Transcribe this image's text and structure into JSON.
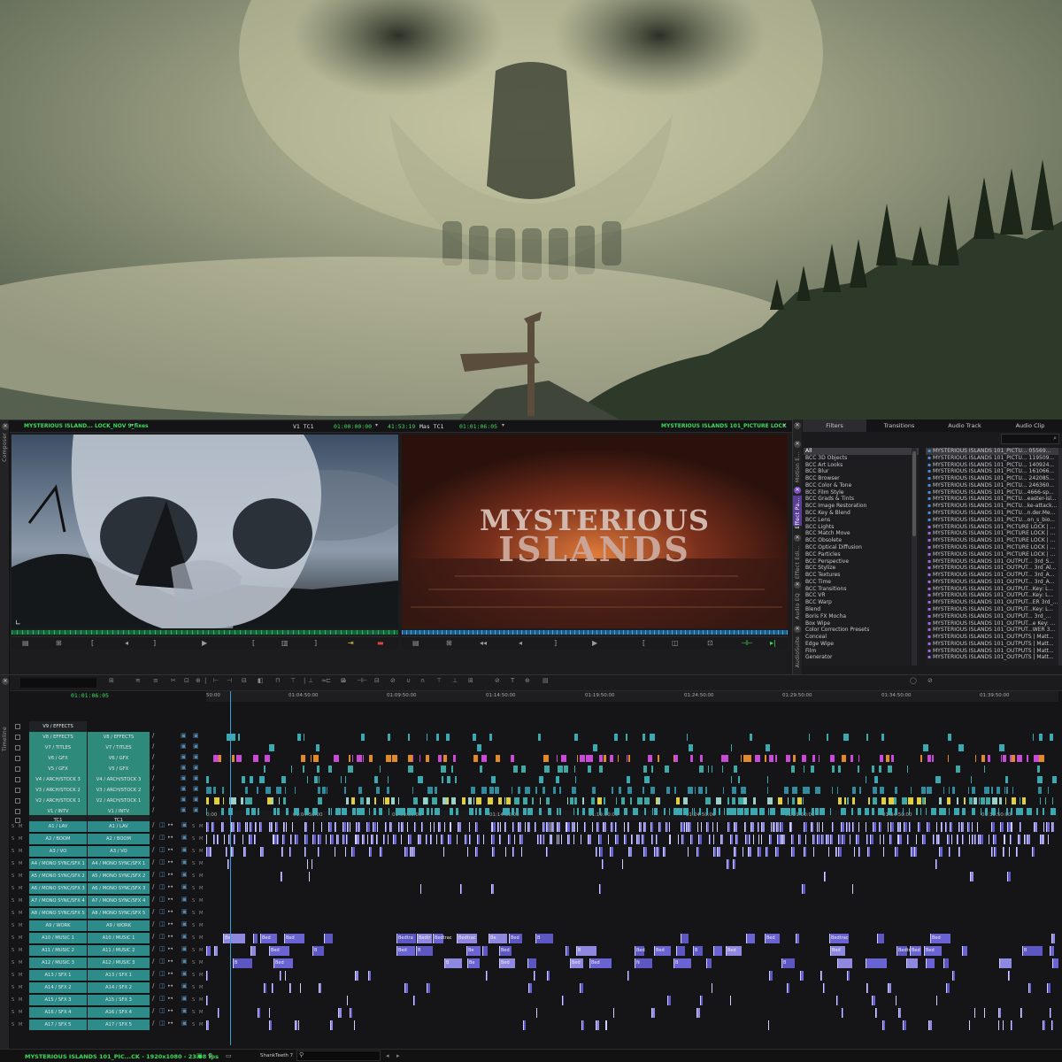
{
  "composer": {
    "side_label": "Composer",
    "source_title": "MYSTERIOUS ISLAND... LOCK_NOV 9_fixes",
    "record_title": "MYSTERIOUS ISLANDS 101_PICTURE LOCK",
    "track_label": "V1  TC1",
    "tc1": "01:00:00:00",
    "duration": "41:53:19",
    "mas_label": "Mas  TC1",
    "tc2": "01:01:06:05",
    "record_overlay_title": "MYSTERIOUS",
    "record_overlay_sub": "ISLANDS"
  },
  "effects": {
    "tabs": [
      "Filters",
      "Transitions",
      "Audio Track",
      "Audio Clip"
    ],
    "side_tabs": [
      "Motion E...",
      "Effect Pa...",
      "Effect Edi...",
      "Audio EQ",
      "AudioSuite"
    ],
    "categories": [
      "All",
      "BCC 3D Objects",
      "BCC Art Looks",
      "BCC Blur",
      "BCC Browser",
      "BCC Color & Tone",
      "BCC Film Style",
      "BCC Grads & Tints",
      "BCC Image Restoration",
      "BCC Key & Blend",
      "BCC Lens",
      "BCC Lights",
      "BCC Match Move",
      "BCC Obsolete",
      "BCC Optical Diffusion",
      "BCC Particles",
      "BCC Perspective",
      "BCC Stylize",
      "BCC Textures",
      "BCC Time",
      "BCC Transitions",
      "BCC VR",
      "BCC Warp",
      "Blend",
      "Boris FX Mocha",
      "Box Wipe",
      "Color Correction Presets",
      "Conceal",
      "Edge Wipe",
      "Film",
      "Generator"
    ],
    "clips": [
      "MYSTERIOUS ISLANDS 101_PICTU... 05569...",
      "MYSTERIOUS ISLANDS 101_PICTU... 119509...",
      "MYSTERIOUS ISLANDS 101_PICTU... 140924...",
      "MYSTERIOUS ISLANDS 101_PICTU... 161066...",
      "MYSTERIOUS ISLANDS 101_PICTU... 242085...",
      "MYSTERIOUS ISLANDS 101_PICTU... 246360...",
      "MYSTERIOUS ISLANDS 101_PICTU...4666-sp...",
      "MYSTERIOUS ISLANDS 101_PICTU...easter-isl...",
      "MYSTERIOUS ISLANDS 101_PICTU...ke-attack...",
      "MYSTERIOUS ISLANDS 101_PICTU...n.der.Me...",
      "MYSTERIOUS ISLANDS 101_PICTU...on_s_bio...",
      "MYSTERIOUS ISLANDS 101_PICTURE LOCK | ...",
      "MYSTERIOUS ISLANDS 101_PICTURE LOCK | ...",
      "MYSTERIOUS ISLANDS 101_PICTURE LOCK | ...",
      "MYSTERIOUS ISLANDS 101_PICTURE LOCK | ...",
      "MYSTERIOUS ISLANDS 101_PICTURE LOCK | ...",
      "MYSTERIOUS ISLANDS 101_OUTPUT... 3rd_S...",
      "MYSTERIOUS ISLANDS 101_OUTPUT... 3rd_Al...",
      "MYSTERIOUS ISLANDS 101_OUTPUT... 3rd_A...",
      "MYSTERIOUS ISLANDS 101_OUTPUT... 3rd_A...",
      "MYSTERIOUS ISLANDS 101_OUTPUT...Key: L...",
      "MYSTERIOUS ISLANDS 101_OUTPUT...Key: L...",
      "MYSTERIOUS ISLANDS 101_OUTPUT...ER 3rd_...",
      "MYSTERIOUS ISLANDS 101_OUTPUT...Key: L...",
      "MYSTERIOUS ISLANDS 101_OUTPUT... 3rd_...",
      "MYSTERIOUS ISLANDS 101_OUTPUT...e Key: ...",
      "MYSTERIOUS ISLANDS 101_OUTPUT...WER 3...",
      "MYSTERIOUS ISLANDS 101_OUTPUTS | Matt...",
      "MYSTERIOUS ISLANDS 101_OUTPUTS | Matt...",
      "MYSTERIOUS ISLANDS 101_OUTPUTS | Matt...",
      "MYSTERIOUS ISLANDS 101_OUTPUTS | Matt..."
    ]
  },
  "timeline": {
    "side_label": "Timeline",
    "current_tc": "01:01:06:05",
    "ruler_ticks": [
      "50:00",
      "01:04:50:00",
      "01:09:50:00",
      "01:14:50:00",
      "01:19:50:00",
      "01:24:50:00",
      "01:29:50:00",
      "01:34:50:00",
      "01:39:50:00"
    ],
    "ruler2_ticks": [
      "0:00",
      "01:04:50:00",
      "01:09:50:00",
      "01:14:50:00",
      "01:19:50:00",
      "01:24:50:00",
      "01:29:50:00",
      "01:34:50:00",
      "01:39:50:00"
    ],
    "video_tracks": [
      {
        "src": "V9 / EFFECTS",
        "rec": ""
      },
      {
        "src": "V8 / EFFECTS",
        "rec": "V8 / EFFECTS"
      },
      {
        "src": "V7 / TITLES",
        "rec": "V7 / TITLES"
      },
      {
        "src": "V6 / GFX",
        "rec": "V6 / GFX"
      },
      {
        "src": "V5 / GFX",
        "rec": "V5 / GFX"
      },
      {
        "src": "V4 / ARCH/STOCK 3",
        "rec": "V4 / ARCH/STOCK 3"
      },
      {
        "src": "V3 / ARCH/STOCK 2",
        "rec": "V3 / ARCH/STOCK 2"
      },
      {
        "src": "V2 / ARCH/STOCK 1",
        "rec": "V2 / ARCH/STOCK 1"
      },
      {
        "src": "V1 / INTV",
        "rec": "V1 / INTV"
      },
      {
        "src": "TC1",
        "rec": "TC1"
      }
    ],
    "audio_tracks": [
      {
        "src": "A1 / LAV",
        "rec": "A1 / LAV"
      },
      {
        "src": "A2 / BOOM",
        "rec": "A2 / BOOM"
      },
      {
        "src": "A3 / VO",
        "rec": "A3 / VO"
      },
      {
        "src": "A4 / MONO SYNC/SFX 1",
        "rec": "A4 / MONO SYNC/SFX 1"
      },
      {
        "src": "A5 / MONO SYNC/SFX 2",
        "rec": "A5 / MONO SYNC/SFX 2"
      },
      {
        "src": "A6 / MONO SYNC/SFX 3",
        "rec": "A6 / MONO SYNC/SFX 3"
      },
      {
        "src": "A7 / MONO SYNC/SFX 4",
        "rec": "A7 / MONO SYNC/SFX 4"
      },
      {
        "src": "A8 / MONO SYNC/SFX 5",
        "rec": "A8 / MONO SYNC/SFX 5"
      },
      {
        "src": "A9 / WORK",
        "rec": "A9 / WORK"
      },
      {
        "src": "A10 / MUSIC 1",
        "rec": "A10 / MUSIC 1"
      },
      {
        "src": "A11 / MUSIC 2",
        "rec": "A11 / MUSIC 2"
      },
      {
        "src": "A12 / MUSIC 3",
        "rec": "A12 / MUSIC 3"
      },
      {
        "src": "A13 / SFX 1",
        "rec": "A13 / SFX 1"
      },
      {
        "src": "A14 / SFX 2",
        "rec": "A14 / SFX 2"
      },
      {
        "src": "A15 / SFX 3",
        "rec": "A15 / SFX 3"
      },
      {
        "src": "A16 / SFX 4",
        "rec": "A16 / SFX 4"
      },
      {
        "src": "A17 / SFX 5",
        "rec": "A17 / SFX 5"
      }
    ],
    "clip_labels": [
      "Be",
      "Bed",
      "Bed",
      "Bedtra",
      "Bedtr",
      "Bedtrac",
      "Bedtrac",
      "Be",
      "Bed",
      "B",
      "Bed",
      "Bedtrac",
      "Bed",
      "Bed",
      "B",
      "Bed",
      "B",
      "Be",
      "Bed",
      "B",
      "Bed",
      "Bed",
      "B",
      "Bed",
      "Bed",
      "Bedtra",
      "Bed",
      "Bed",
      "B",
      "B",
      "Bed",
      "B",
      "Be",
      "Bed",
      "Bed",
      "Bed",
      "N",
      "B",
      "B"
    ],
    "status_text": "MYSTERIOUS ISLANDS 101_PIC...CK - 1920x1080 - 23.98 fps",
    "search_label": "ShankTeeth 7"
  },
  "colors": {
    "video_track": "#2e8a7a",
    "audio_track": "#2d8c8a",
    "clip_teal": "#3fa7a4",
    "clip_magenta": "#c94ad6",
    "clip_orange": "#e08a2c",
    "clip_purple": "#6a63d4",
    "status_green": "#3ddc5a"
  }
}
